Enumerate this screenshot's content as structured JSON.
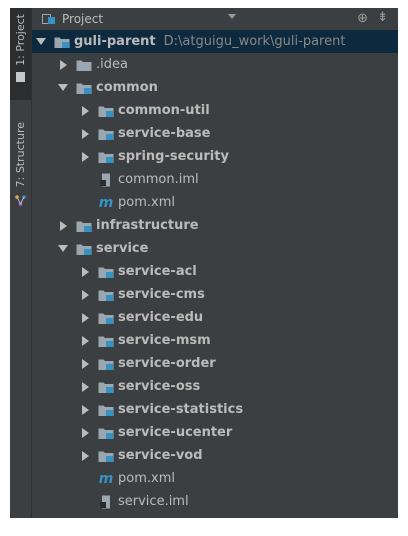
{
  "stripe": {
    "project_label": "1: Project",
    "structure_label": "7: Structure"
  },
  "header": {
    "title": "Project"
  },
  "tree": [
    {
      "label": "guli-parent",
      "hint": "D:\\atguigu_work\\guli-parent",
      "level": 0,
      "expand": "down",
      "icon": "module-folder-icon",
      "bold": true,
      "selected": true
    },
    {
      "label": ".idea",
      "level": 1,
      "expand": "right",
      "icon": "folder-icon",
      "bold": false
    },
    {
      "label": "common",
      "level": 1,
      "expand": "down",
      "icon": "module-folder-icon",
      "bold": true
    },
    {
      "label": "common-util",
      "level": 2,
      "expand": "right",
      "icon": "module-folder-icon",
      "bold": true
    },
    {
      "label": "service-base",
      "level": 2,
      "expand": "right",
      "icon": "module-folder-icon",
      "bold": true
    },
    {
      "label": "spring-security",
      "level": 2,
      "expand": "right",
      "icon": "module-folder-icon",
      "bold": true
    },
    {
      "label": "common.iml",
      "level": 2,
      "expand": "none",
      "icon": "iml-file-icon",
      "bold": false
    },
    {
      "label": "pom.xml",
      "level": 2,
      "expand": "none",
      "icon": "maven-m-icon",
      "bold": false
    },
    {
      "label": "infrastructure",
      "level": 1,
      "expand": "right",
      "icon": "module-folder-icon",
      "bold": true
    },
    {
      "label": "service",
      "level": 1,
      "expand": "down",
      "icon": "module-folder-icon",
      "bold": true
    },
    {
      "label": "service-acl",
      "level": 2,
      "expand": "right",
      "icon": "module-folder-icon",
      "bold": true
    },
    {
      "label": "service-cms",
      "level": 2,
      "expand": "right",
      "icon": "module-folder-icon",
      "bold": true
    },
    {
      "label": "service-edu",
      "level": 2,
      "expand": "right",
      "icon": "module-folder-icon",
      "bold": true
    },
    {
      "label": "service-msm",
      "level": 2,
      "expand": "right",
      "icon": "module-folder-icon",
      "bold": true
    },
    {
      "label": "service-order",
      "level": 2,
      "expand": "right",
      "icon": "module-folder-icon",
      "bold": true
    },
    {
      "label": "service-oss",
      "level": 2,
      "expand": "right",
      "icon": "module-folder-icon",
      "bold": true
    },
    {
      "label": "service-statistics",
      "level": 2,
      "expand": "right",
      "icon": "module-folder-icon",
      "bold": true
    },
    {
      "label": "service-ucenter",
      "level": 2,
      "expand": "right",
      "icon": "module-folder-icon",
      "bold": true
    },
    {
      "label": "service-vod",
      "level": 2,
      "expand": "right",
      "icon": "module-folder-icon",
      "bold": true
    },
    {
      "label": "pom.xml",
      "level": 2,
      "expand": "none",
      "icon": "maven-m-icon",
      "bold": false
    },
    {
      "label": "service.iml",
      "level": 2,
      "expand": "none",
      "icon": "iml-file-icon",
      "bold": false
    }
  ],
  "colors": {
    "background": "#3c3f41",
    "selected": "#0d293e",
    "text": "#bbbbbb",
    "module_blue": "#3592c4",
    "folder_gray": "#9aa7b0"
  }
}
